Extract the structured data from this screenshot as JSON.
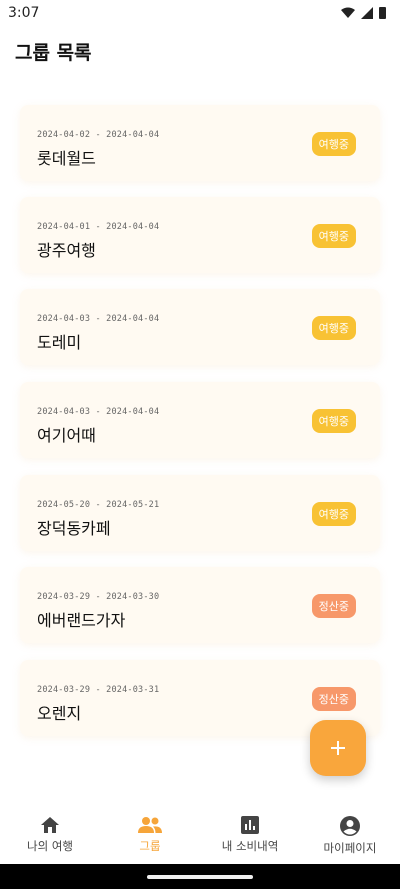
{
  "status_bar": {
    "time": "3:07"
  },
  "header": {
    "title": "그룹 목록"
  },
  "groups": [
    {
      "dates": "2024-04-02 - 2024-04-04",
      "name": "롯데월드",
      "status": "여행중",
      "status_color": "#f8c234"
    },
    {
      "dates": "2024-04-01 - 2024-04-04",
      "name": "광주여행",
      "status": "여행중",
      "status_color": "#f8c234"
    },
    {
      "dates": "2024-04-03 - 2024-04-04",
      "name": "도레미",
      "status": "여행중",
      "status_color": "#f8c234"
    },
    {
      "dates": "2024-04-03 - 2024-04-04",
      "name": "여기어때",
      "status": "여행중",
      "status_color": "#f8c234"
    },
    {
      "dates": "2024-05-20 - 2024-05-21",
      "name": "장덕동카페",
      "status": "여행중",
      "status_color": "#f8c234"
    },
    {
      "dates": "2024-03-29 - 2024-03-30",
      "name": "에버랜드가자",
      "status": "정산중",
      "status_color": "#f7986a"
    },
    {
      "dates": "2024-03-29 - 2024-03-31",
      "name": "오렌지",
      "status": "정산중",
      "status_color": "#f7986a"
    }
  ],
  "fab": {
    "label": "+",
    "icon": "add-icon"
  },
  "bottom_nav": {
    "items": [
      {
        "label": "나의 여행",
        "icon": "home-icon",
        "active": false
      },
      {
        "label": "그룹",
        "icon": "group-icon",
        "active": true
      },
      {
        "label": "내 소비내역",
        "icon": "chart-icon",
        "active": false
      },
      {
        "label": "마이페이지",
        "icon": "account-icon",
        "active": false
      }
    ]
  },
  "colors": {
    "accent": "#f6a53a",
    "card_bg": "#fffaf2",
    "traveling_badge": "#f8c234",
    "settling_badge": "#f7986a"
  }
}
